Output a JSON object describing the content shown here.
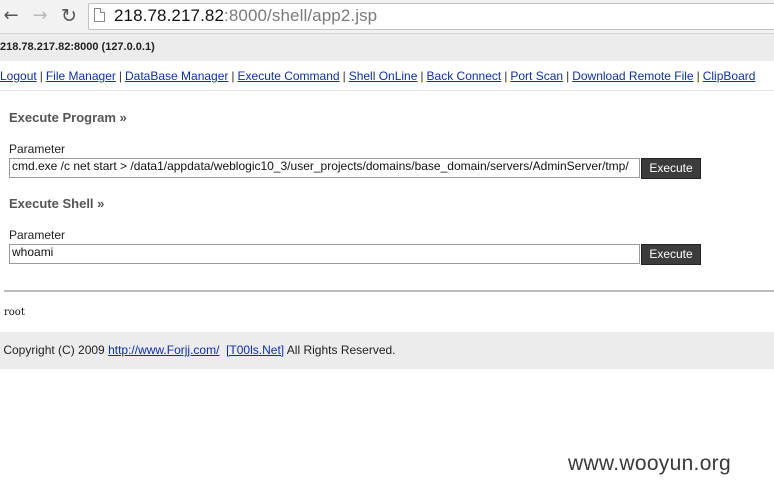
{
  "browser": {
    "url_host": "218.78.217.82",
    "url_rest": ":8000/shell/app2.jsp",
    "back_icon": "arrow-left",
    "forward_icon": "arrow-right",
    "reload_icon": "reload"
  },
  "header": {
    "hostline": "218.78.217.82:8000 (127.0.0.1)"
  },
  "nav": {
    "links": [
      "Logout",
      "File Manager",
      "DataBase Manager",
      "Execute Command",
      "Shell OnLine",
      "Back Connect",
      "Port Scan",
      "Download Remote File",
      "ClipBoard"
    ],
    "separator": "|"
  },
  "execute_program": {
    "title": "Execute Program »",
    "param_label": "Parameter",
    "param_value": "cmd.exe /c net start > /data1/appdata/weblogic10_3/user_projects/domains/base_domain/servers/AdminServer/tmp/",
    "button_label": "Execute"
  },
  "execute_shell": {
    "title": "Execute Shell »",
    "param_label": "Parameter",
    "param_value": "whoami",
    "button_label": "Execute"
  },
  "output": {
    "text": "root"
  },
  "footer": {
    "prefix": "Copyright (C) 2009 ",
    "link1": "http://www.Forjj.com/",
    "link2": "[T00ls.Net]",
    "suffix": " All Rights Reserved."
  },
  "watermark": "www.wooyun.org"
}
